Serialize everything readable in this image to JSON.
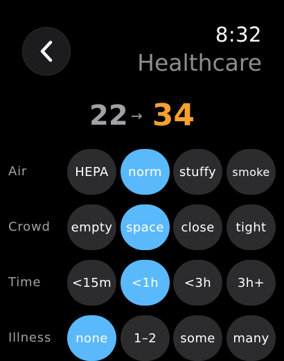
{
  "header": {
    "back_icon": "chevron-left-icon",
    "time": "8:32",
    "title": "Healthcare"
  },
  "score": {
    "previous": "22",
    "arrow": "→",
    "current": "34"
  },
  "colors": {
    "accent": "#5ab9fb",
    "score_highlight": "#f5a031",
    "pill_background": "#2c2c2e"
  },
  "rows": [
    {
      "label": "Air",
      "options": [
        "HEPA",
        "norm",
        "stuffy",
        "smoke"
      ],
      "selected": "norm"
    },
    {
      "label": "Crowd",
      "options": [
        "empty",
        "space",
        "close",
        "tight"
      ],
      "selected": "space"
    },
    {
      "label": "Time",
      "options": [
        "<15m",
        "<1h",
        "<3h",
        "3h+"
      ],
      "selected": "<1h"
    },
    {
      "label": "Illness",
      "options": [
        "none",
        "1–2",
        "some",
        "many"
      ],
      "selected": "none"
    }
  ]
}
